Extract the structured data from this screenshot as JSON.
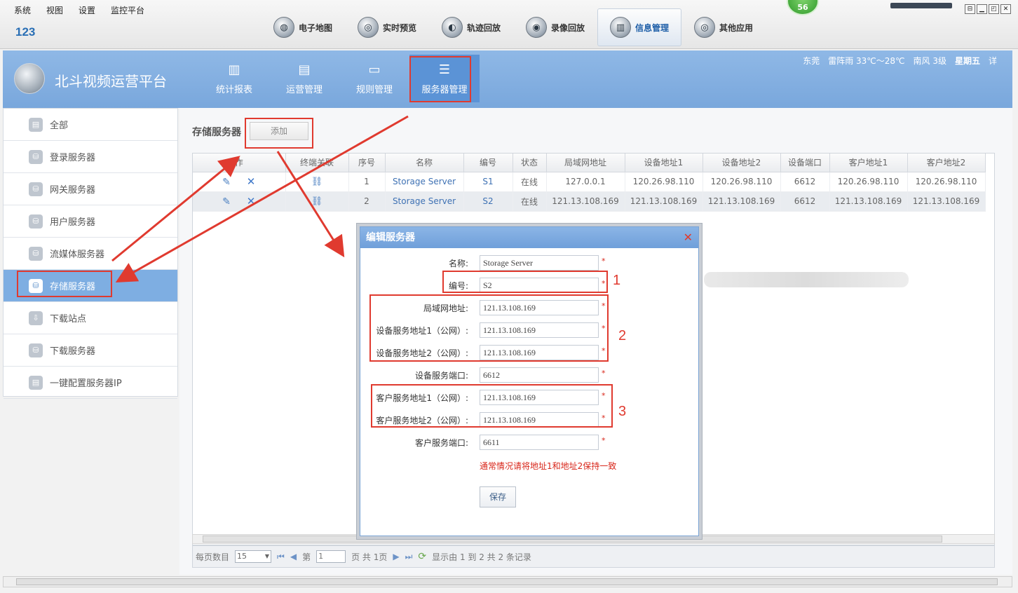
{
  "menu": [
    "系统",
    "视图",
    "设置",
    "监控平台"
  ],
  "user_id": "123",
  "main_tabs": [
    {
      "label": "电子地图",
      "icon": "globe-icon",
      "glyph": "◍"
    },
    {
      "label": "实时预览",
      "icon": "magnifier-icon",
      "glyph": "◎"
    },
    {
      "label": "轨迹回放",
      "icon": "track-icon",
      "glyph": "◐"
    },
    {
      "label": "录像回放",
      "icon": "film-reel-icon",
      "glyph": "◉"
    },
    {
      "label": "信息管理",
      "icon": "info-chart-icon",
      "glyph": "▥"
    },
    {
      "label": "其他应用",
      "icon": "app-disc-icon",
      "glyph": "◎"
    }
  ],
  "badge": "56",
  "window_buttons": [
    "⊟",
    "▁",
    "◰",
    "✕"
  ],
  "platform_title": "北斗视频运营平台",
  "sub_tabs": [
    {
      "label": "统计报表",
      "icon": "bar-chart-icon",
      "glyph": "▥"
    },
    {
      "label": "运营管理",
      "icon": "document-icon",
      "glyph": "▤"
    },
    {
      "label": "规则管理",
      "icon": "frame-icon",
      "glyph": "▭"
    },
    {
      "label": "服务器管理",
      "icon": "sliders-icon",
      "glyph": "☰"
    }
  ],
  "weather": {
    "city": "东莞",
    "desc": "雷阵雨 33℃～28℃",
    "wind": "南风 3级",
    "day": "星期五",
    "more": "详"
  },
  "sidebar": [
    {
      "label": "全部",
      "icon": "server-all-icon"
    },
    {
      "label": "登录服务器",
      "icon": "db-login-icon"
    },
    {
      "label": "网关服务器",
      "icon": "db-gateway-icon"
    },
    {
      "label": "用户服务器",
      "icon": "db-user-icon"
    },
    {
      "label": "流媒体服务器",
      "icon": "db-stream-icon"
    },
    {
      "label": "存储服务器",
      "icon": "db-storage-icon"
    },
    {
      "label": "下载站点",
      "icon": "download-site-icon"
    },
    {
      "label": "下载服务器",
      "icon": "db-download-icon"
    },
    {
      "label": "一键配置服务器IP",
      "icon": "one-click-config-icon"
    }
  ],
  "section_title": "存储服务器",
  "add_label": "添加",
  "table": {
    "headers": [
      "作",
      "终端关联",
      "序号",
      "名称",
      "编号",
      "状态",
      "局域网地址",
      "设备地址1",
      "设备地址2",
      "设备端口",
      "客户地址1",
      "客户地址2"
    ],
    "rows": [
      {
        "seq": "1",
        "name": "Storage Server",
        "code": "S1",
        "status": "在线",
        "lan": "127.0.0.1",
        "dev1": "120.26.98.110",
        "dev2": "120.26.98.110",
        "dport": "6612",
        "cli1": "120.26.98.110",
        "cli2": "120.26.98.110"
      },
      {
        "seq": "2",
        "name": "Storage Server",
        "code": "S2",
        "status": "在线",
        "lan": "121.13.108.169",
        "dev1": "121.13.108.169",
        "dev2": "121.13.108.169",
        "dport": "6612",
        "cli1": "121.13.108.169",
        "cli2": "121.13.108.169"
      }
    ]
  },
  "pager": {
    "per_page_label": "每页数目",
    "per_page": "15",
    "page_prefix": "第",
    "page": "1",
    "page_suffix": "页 共 1页",
    "summary": "显示由 1 到 2 共 2 条记录"
  },
  "dialog": {
    "title": "编辑服务器",
    "fields": [
      {
        "label": "名称:",
        "value": "Storage Server"
      },
      {
        "label": "编号:",
        "value": "S2"
      },
      {
        "label": "局域网地址:",
        "value": "121.13.108.169"
      },
      {
        "label": "设备服务地址1（公网）:",
        "value": "121.13.108.169"
      },
      {
        "label": "设备服务地址2（公网）:",
        "value": "121.13.108.169"
      },
      {
        "label": "设备服务端口:",
        "value": "6612"
      },
      {
        "label": "客户服务地址1（公网）:",
        "value": "121.13.108.169"
      },
      {
        "label": "客户服务地址2（公网）:",
        "value": "121.13.108.169"
      },
      {
        "label": "客户服务端口:",
        "value": "6611"
      }
    ],
    "required_mark": "*",
    "hint": "通常情况请将地址1和地址2保持一致",
    "save_label": "保存"
  },
  "annotations": [
    "1",
    "2",
    "3"
  ],
  "colors": {
    "accent_blue": "#79a7dc",
    "annotation_red": "#e03a2f",
    "required_red": "#d8261a"
  }
}
